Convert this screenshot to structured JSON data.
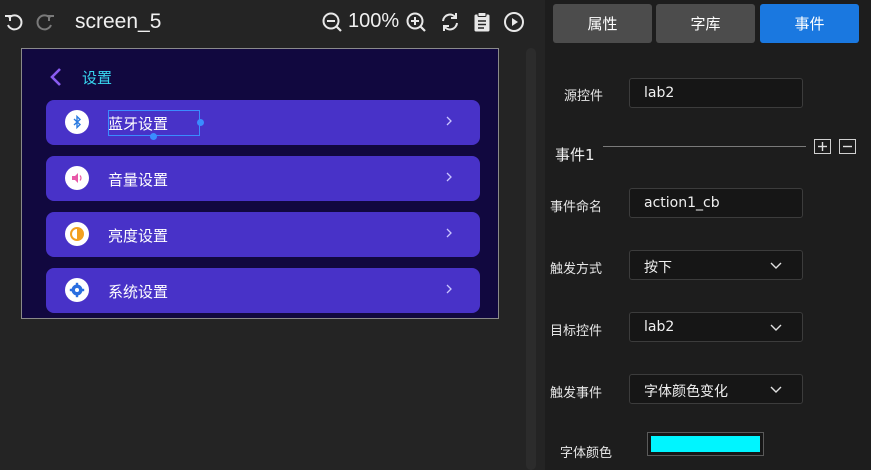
{
  "toolbar": {
    "undo_icon": "undo-icon",
    "redo_icon": "redo-icon",
    "screen_name": "screen_5",
    "zoom": "100%",
    "zoom_out_icon": "zoom-out-icon",
    "zoom_in_icon": "zoom-in-icon",
    "refresh_icon": "refresh-icon",
    "clipboard_icon": "clipboard-icon",
    "play_icon": "play-icon"
  },
  "device": {
    "title": "设置",
    "rows": [
      {
        "label": "蓝牙设置",
        "icon": "bluetooth-icon"
      },
      {
        "label": "音量设置",
        "icon": "volume-icon"
      },
      {
        "label": "亮度设置",
        "icon": "brightness-icon"
      },
      {
        "label": "系统设置",
        "icon": "system-settings-icon"
      }
    ]
  },
  "panel": {
    "tabs": [
      {
        "label": "属性",
        "active": false
      },
      {
        "label": "字库",
        "active": false
      },
      {
        "label": "事件",
        "active": true
      }
    ],
    "source_label": "源控件",
    "source_value": "lab2",
    "event_header": "事件1",
    "event_name_label": "事件命名",
    "event_name_value": "action1_cb",
    "trigger_mode_label": "触发方式",
    "trigger_mode_value": "按下",
    "target_label": "目标控件",
    "target_value": "lab2",
    "trigger_event_label": "触发事件",
    "trigger_event_value": "字体颜色变化",
    "font_color_label": "字体颜色",
    "font_color_value": "#00f5ff"
  },
  "colors": {
    "accent": "#1a78e0",
    "device_bg": "#11083f",
    "row_bg": "#4832c8",
    "title_color": "#38d7f0"
  }
}
